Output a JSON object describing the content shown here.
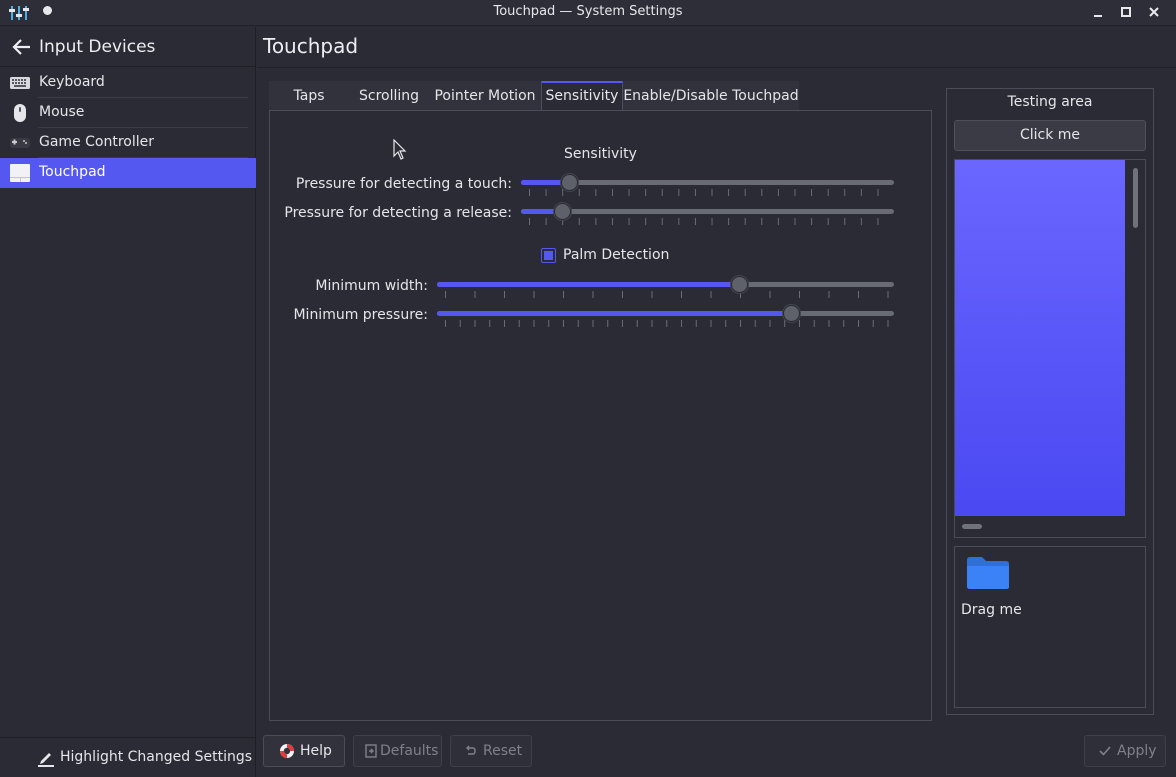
{
  "window": {
    "title": "Touchpad — System Settings"
  },
  "sidebar": {
    "header": "Input Devices",
    "items": [
      {
        "label": "Keyboard",
        "icon": "keyboard-icon"
      },
      {
        "label": "Mouse",
        "icon": "mouse-icon"
      },
      {
        "label": "Game Controller",
        "icon": "gamepad-icon"
      },
      {
        "label": "Touchpad",
        "icon": "touchpad-icon",
        "active": true
      }
    ],
    "footer": "Highlight Changed Settings"
  },
  "page": {
    "title": "Touchpad"
  },
  "tabs": [
    {
      "label": "Taps"
    },
    {
      "label": "Scrolling"
    },
    {
      "label": "Pointer Motion"
    },
    {
      "label": "Sensitivity",
      "active": true
    },
    {
      "label": "Enable/Disable Touchpad"
    }
  ],
  "sensitivity": {
    "section_title": "Sensitivity",
    "touch_label": "Pressure for detecting a touch:",
    "touch_value": 0.13,
    "release_label": "Pressure for detecting a release:",
    "release_value": 0.11,
    "palm_label": "Palm Detection",
    "palm_checked": true,
    "min_width_label": "Minimum width:",
    "min_width_value": 0.66,
    "min_pressure_label": "Minimum pressure:",
    "min_pressure_value": 0.775
  },
  "testing": {
    "title": "Testing area",
    "click_button": "Click me",
    "drag_label": "Drag me"
  },
  "buttons": {
    "help": "Help",
    "defaults": "Defaults",
    "reset": "Reset",
    "apply": "Apply"
  },
  "colors": {
    "accent": "#5558f0",
    "background": "#2a2b34",
    "folder": "#3b82f6"
  }
}
